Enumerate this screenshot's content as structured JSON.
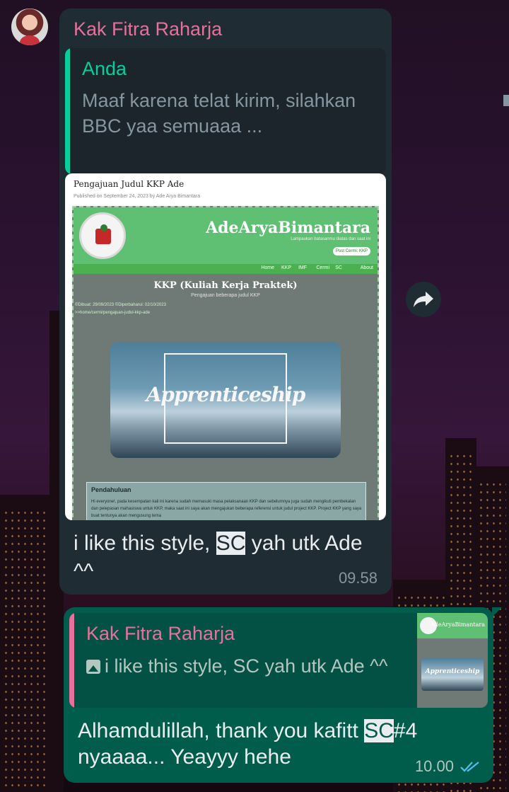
{
  "incoming": {
    "sender": "Kak Fitra Raharja",
    "quote": {
      "author": "Anda",
      "text": "Maaf karena telat kirim, silahkan BBC yaa semuaaa ..."
    },
    "image": {
      "title": "Pengajuan Judul KKP Ade",
      "subtitle": "Published on September 24, 2023 by Ade Arya Bimantara",
      "site_name": "AdeAryaBimantara",
      "site_tagline": "Lampaukan batasanmu diatas dan saat ini",
      "site_button": "Post Cermi: KKP",
      "nav": [
        "Home",
        "KKP",
        "IMF",
        "Cermi",
        "SC",
        "About"
      ],
      "heading": "KKP (Kuliah Kerja Praktek)",
      "subheading": "Pengajuan beberapa judul KKP",
      "badges": "©Dibuat: 29/09/2023   ©Diperbaharui: 02/10/2023",
      "path": ">>home/cermi/pengajuan-judul-kkp-ade",
      "hero_text": "Apprenticeship",
      "section_title": "Pendahuluan",
      "section_text": "Hi everyone!, pada kesempatan kali ini karena sudah memasuki masa pelaksanaan KKP dan sebelumnya juga sudah mengikuti pembekalan dan pelepasan mahasiswa untuk KKP, maka saat ini saya akan mengajukan beberapa referensi untuk judul project KKP. Project KKP yang saya buat tentunya akan mengusung tema"
    },
    "text_before": "i like this style, ",
    "text_highlight": "SC",
    "text_after": " yah utk Ade ^^",
    "time": "09.58"
  },
  "outgoing": {
    "quote": {
      "author": "Kak Fitra Raharja",
      "text": "i like this style, SC yah utk Ade ^^",
      "thumb_site_name": "AdeAryaBimantara",
      "thumb_hero_text": "Apprenticeship"
    },
    "text_before": "Alhamdulillah, thank you  kafitt ",
    "text_highlight": "SC",
    "text_after": "#4 nyaaaa... Yeayyy hehe",
    "time": "10.00",
    "status_icon": "double-check-icon",
    "status_color": "#53bdeb"
  },
  "colors": {
    "incoming_bubble": "#202c33",
    "outgoing_bubble": "#005c4b",
    "sender_name": "#e5719c",
    "quote_author_self": "#06cf9c"
  }
}
